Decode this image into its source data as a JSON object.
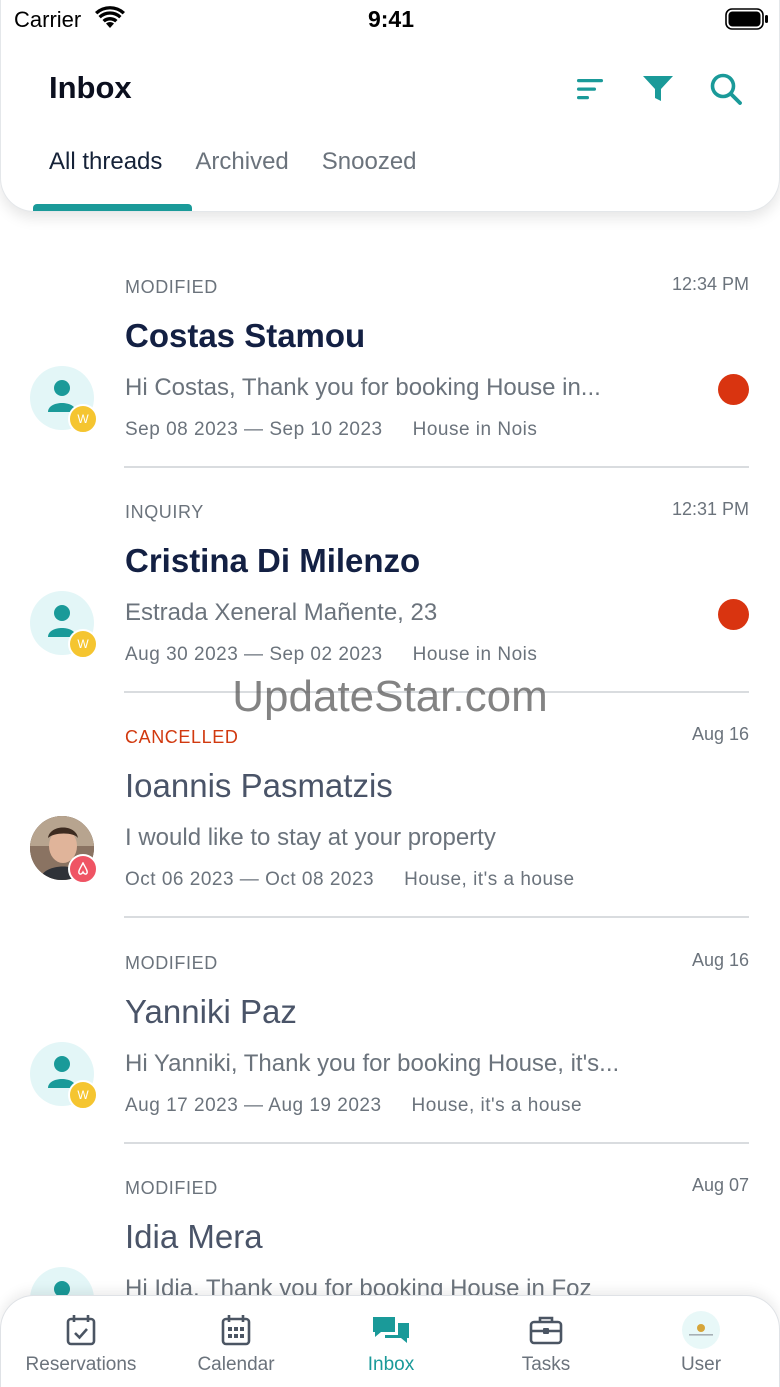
{
  "status_bar": {
    "carrier": "Carrier",
    "time": "9:41"
  },
  "header": {
    "title": "Inbox",
    "tabs": [
      {
        "label": "All threads",
        "active": true
      },
      {
        "label": "Archived",
        "active": false
      },
      {
        "label": "Snoozed",
        "active": false
      }
    ],
    "icons": [
      "sort-icon",
      "filter-icon",
      "search-icon"
    ]
  },
  "colors": {
    "accent": "#1a9a99",
    "unread_dot": "#d93410",
    "cancelled": "#d1390f",
    "name": "#132043"
  },
  "threads": [
    {
      "status": "MODIFIED",
      "time": "12:34 PM",
      "name": "Costas Stamou",
      "message": "Hi Costas, Thank you for booking House in...",
      "dates": "Sep 08 2023 — Sep 10 2023",
      "property": "House in Nois",
      "unread": true,
      "avatar": "user-icon",
      "channel": "W"
    },
    {
      "status": "INQUIRY",
      "time": "12:31 PM",
      "name": "Cristina Di Milenzo",
      "message": "Estrada Xeneral Mañente, 23",
      "dates": "Aug 30 2023 — Sep 02 2023",
      "property": "House in Nois",
      "unread": true,
      "avatar": "user-icon",
      "channel": "W"
    },
    {
      "status": "CANCELLED",
      "time": "Aug 16",
      "name": "Ioannis Pasmatzis",
      "message": "I would like to stay at your property",
      "dates": "Oct 06 2023 — Oct 08 2023",
      "property": "House, it's a house",
      "unread": false,
      "avatar": "photo",
      "channel": "airbnb"
    },
    {
      "status": "MODIFIED",
      "time": "Aug 16",
      "name": "Yanniki Paz",
      "message": "Hi Yanniki, Thank you for booking House, it's...",
      "dates": "Aug 17 2023 — Aug 19 2023",
      "property": "House, it's a house",
      "unread": false,
      "avatar": "user-icon",
      "channel": "W"
    },
    {
      "status": "MODIFIED",
      "time": "Aug 07",
      "name": "Idia Mera",
      "message": "Hi Idia, Thank you for booking House in Foz",
      "dates": "",
      "property": "",
      "unread": false,
      "avatar": "user-icon",
      "channel": "W"
    }
  ],
  "watermark": "UpdateStar.com",
  "tabbar": {
    "items": [
      {
        "label": "Reservations",
        "icon": "calendar-check-icon",
        "active": false
      },
      {
        "label": "Calendar",
        "icon": "calendar-grid-icon",
        "active": false
      },
      {
        "label": "Inbox",
        "icon": "chat-bubbles-icon",
        "active": true
      },
      {
        "label": "Tasks",
        "icon": "briefcase-icon",
        "active": false
      },
      {
        "label": "User",
        "icon": "user-logo-icon",
        "active": false
      }
    ]
  }
}
